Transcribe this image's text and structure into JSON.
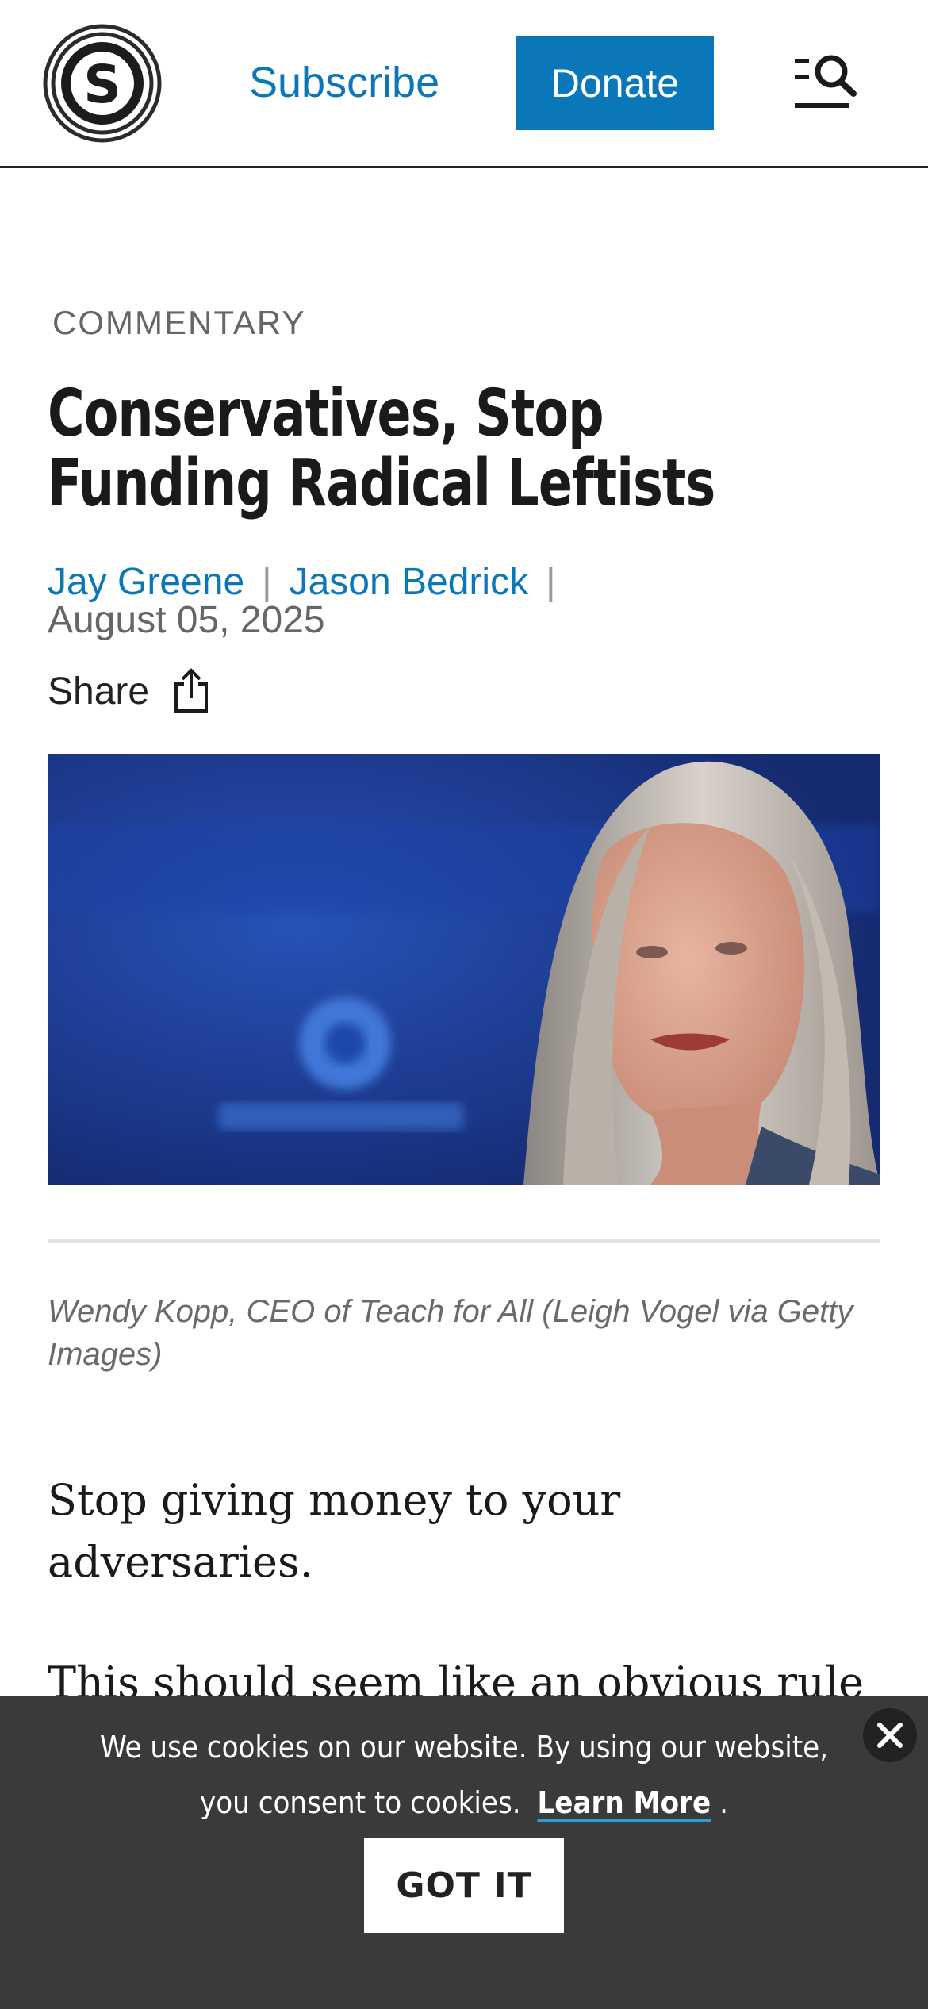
{
  "header": {
    "logo_letter": "S",
    "subscribe_label": "Subscribe",
    "donate_label": "Donate",
    "colors": {
      "accent": "#0a78b8",
      "border": "#222222"
    }
  },
  "article": {
    "category": "COMMENTARY",
    "headline": "Conservatives, Stop Funding Radical Leftists",
    "authors": [
      "Jay Greene",
      "Jason Bedrick"
    ],
    "author_separator": "|",
    "date": "August 05, 2025",
    "share_label": "Share",
    "image_caption": "Wendy Kopp, CEO of Teach for All (Leigh Vogel via Getty Images)",
    "paragraphs": [
      "Stop giving money to your adversaries.",
      "This should seem like an obvious rule"
    ]
  },
  "cookie_banner": {
    "message": "We use cookies on our website. By using our website, you consent to cookies.",
    "learn_more_label": "Learn More",
    "trailing": ".",
    "button_label": "GOT IT",
    "background": "#3a3a3a"
  }
}
